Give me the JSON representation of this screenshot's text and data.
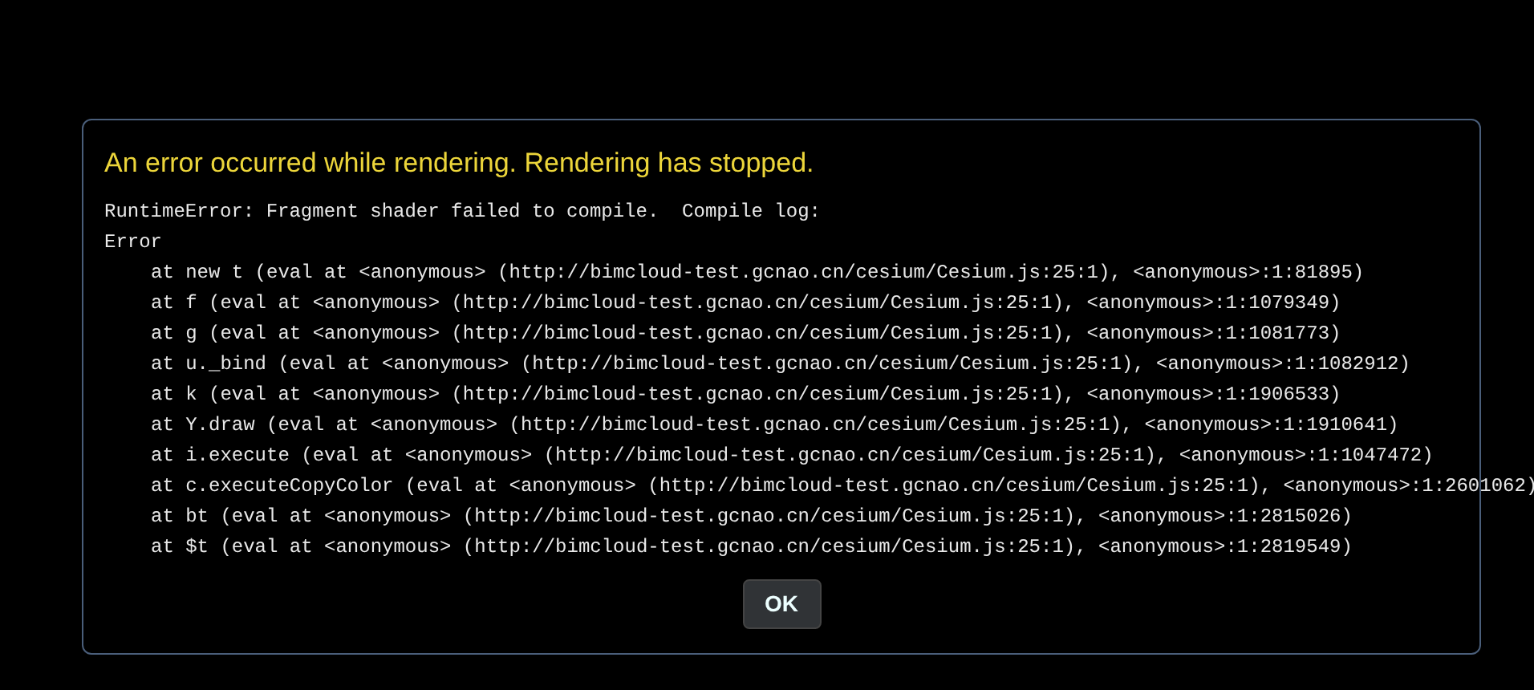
{
  "dialog": {
    "title": "An error occurred while rendering. Rendering has stopped.",
    "message": [
      "RuntimeError: Fragment shader failed to compile.  Compile log:",
      "Error"
    ],
    "stack_trace": [
      "at new t (eval at <anonymous> (http://bimcloud-test.gcnao.cn/cesium/Cesium.js:25:1), <anonymous>:1:81895)",
      "at f (eval at <anonymous> (http://bimcloud-test.gcnao.cn/cesium/Cesium.js:25:1), <anonymous>:1:1079349)",
      "at g (eval at <anonymous> (http://bimcloud-test.gcnao.cn/cesium/Cesium.js:25:1), <anonymous>:1:1081773)",
      "at u._bind (eval at <anonymous> (http://bimcloud-test.gcnao.cn/cesium/Cesium.js:25:1), <anonymous>:1:1082912)",
      "at k (eval at <anonymous> (http://bimcloud-test.gcnao.cn/cesium/Cesium.js:25:1), <anonymous>:1:1906533)",
      "at Y.draw (eval at <anonymous> (http://bimcloud-test.gcnao.cn/cesium/Cesium.js:25:1), <anonymous>:1:1910641)",
      "at i.execute (eval at <anonymous> (http://bimcloud-test.gcnao.cn/cesium/Cesium.js:25:1), <anonymous>:1:1047472)",
      "at c.executeCopyColor (eval at <anonymous> (http://bimcloud-test.gcnao.cn/cesium/Cesium.js:25:1), <anonymous>:1:2601062)",
      "at bt (eval at <anonymous> (http://bimcloud-test.gcnao.cn/cesium/Cesium.js:25:1), <anonymous>:1:2815026)",
      "at $t (eval at <anonymous> (http://bimcloud-test.gcnao.cn/cesium/Cesium.js:25:1), <anonymous>:1:2819549)"
    ],
    "buttons": [
      "OK"
    ]
  }
}
